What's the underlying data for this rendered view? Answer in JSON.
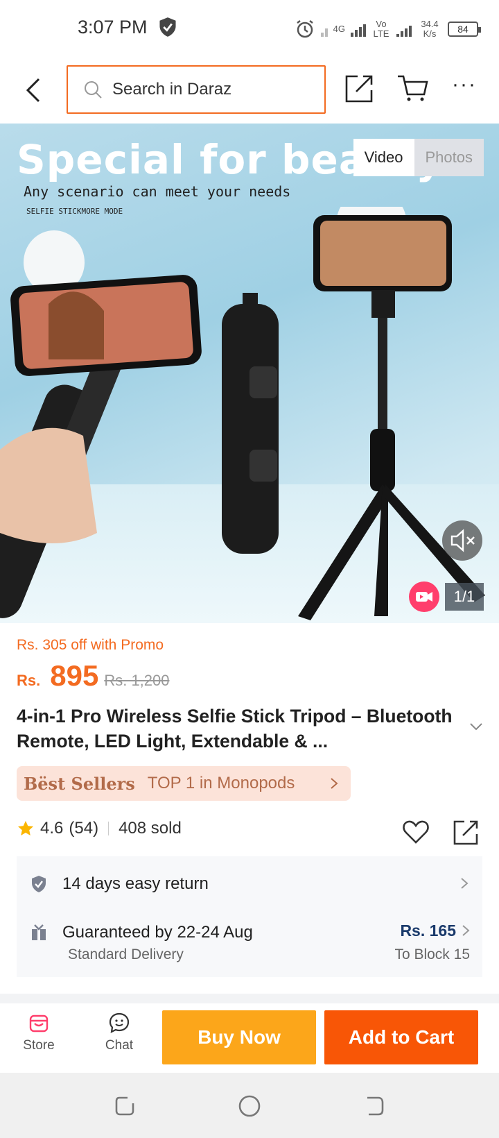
{
  "status_bar": {
    "time": "3:07 PM",
    "network_4g": "4G",
    "volte": "Vo LTE",
    "speed": "34.4 K/s",
    "battery": "84"
  },
  "header": {
    "search_placeholder": "Search in Daraz"
  },
  "media": {
    "promo_title": "Special for beauty",
    "promo_subtitle": "Any scenario can meet your needs",
    "promo_subtitle2": "SELFIE STICKMORE MODE",
    "tabs": [
      {
        "label": "Video",
        "active": true
      },
      {
        "label": "Photos",
        "active": false
      }
    ],
    "counter": "1/1"
  },
  "price": {
    "promo": "Rs. 305 off with Promo",
    "currency": "Rs.",
    "current": "895",
    "original": "Rs. 1,200"
  },
  "product": {
    "title": "4-in-1 Pro Wireless Selfie Stick Tripod – Bluetooth Remote, LED Light, Extendable & ..."
  },
  "bestseller": {
    "badge": "Bëst Sellers",
    "text": "TOP 1 in Monopods"
  },
  "rating": {
    "score": "4.6",
    "count": "(54)",
    "sold": "408 sold"
  },
  "service": {
    "return_text": "14 days easy return",
    "delivery_text": "Guaranteed by 22-24 Aug",
    "delivery_type": "Standard Delivery",
    "delivery_fee": "Rs. 165",
    "delivery_to": "To Block 15"
  },
  "bottom_bar": {
    "store_label": "Store",
    "chat_label": "Chat",
    "buy_now": "Buy Now",
    "add_to_cart": "Add to Cart"
  },
  "colors": {
    "accent": "#f85606",
    "buy_now": "#fca61a",
    "promo_text": "#f36b21"
  }
}
